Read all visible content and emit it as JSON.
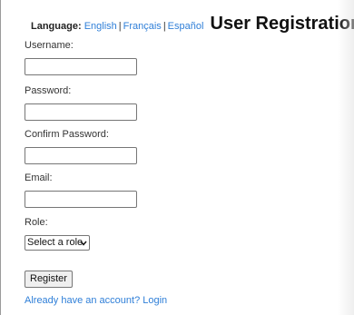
{
  "header": {
    "language_label": "Language:",
    "languages": [
      "English",
      "Français",
      "Español"
    ],
    "separator": "|",
    "title": "User Registration"
  },
  "form": {
    "username_label": "Username:",
    "username_value": "",
    "password_label": "Password:",
    "password_value": "",
    "confirm_password_label": "Confirm Password:",
    "confirm_password_value": "",
    "email_label": "Email:",
    "email_value": "",
    "role_label": "Role:",
    "role_selected": "Select a role",
    "register_label": "Register",
    "login_link": "Already have an account? Login"
  },
  "colors": {
    "link": "#2f7fd8",
    "input_border": "#767676",
    "button_bg": "#efefef"
  },
  "icons": {
    "select_arrow": "chevron-down-icon"
  }
}
